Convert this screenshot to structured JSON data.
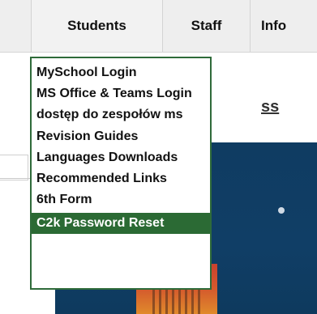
{
  "nav": {
    "tabs": [
      {
        "label": "Students"
      },
      {
        "label": "Staff"
      },
      {
        "label": "Info"
      }
    ]
  },
  "dropdown": {
    "items": [
      {
        "label": "MySchool Login"
      },
      {
        "label": "MS Office & Teams Login"
      },
      {
        "label": "dostęp do zespołów ms"
      },
      {
        "label": "Revision Guides"
      },
      {
        "label": "Languages Downloads"
      },
      {
        "label": "Recommended Links"
      },
      {
        "label": "6th Form"
      },
      {
        "label": "C2k Password Reset"
      }
    ],
    "active_index": 7
  },
  "background": {
    "partial_text": "ss"
  },
  "colors": {
    "dropdown_border": "#2f6b3a",
    "active_item_bg": "#2b6a34",
    "hero_bg": "#0f3c62"
  }
}
